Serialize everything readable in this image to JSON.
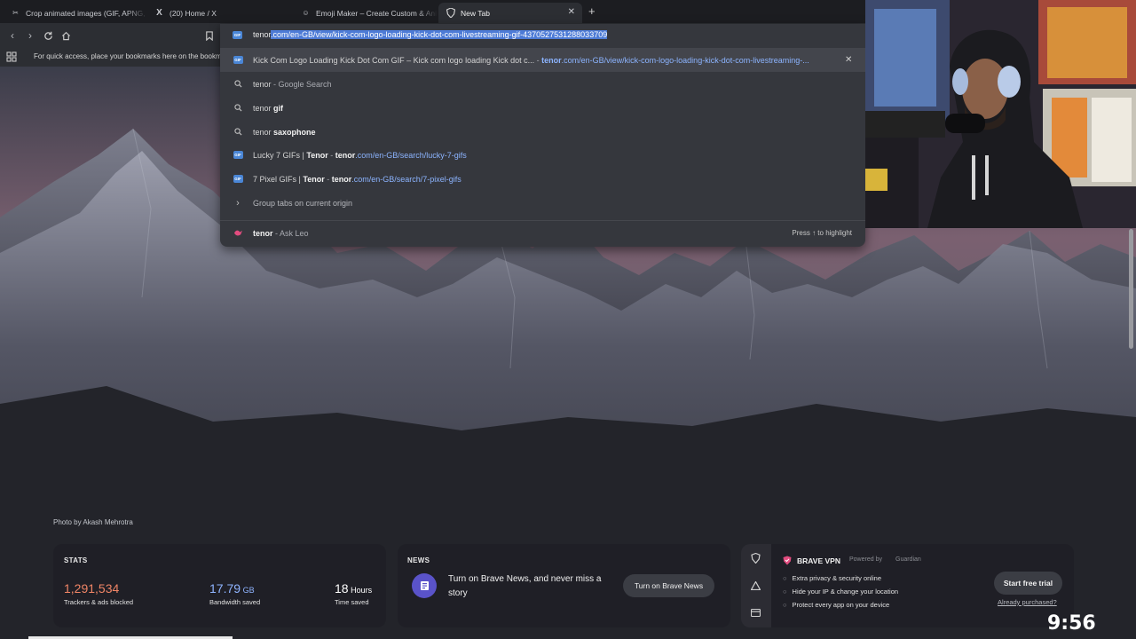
{
  "tabs": [
    {
      "title": "Crop animated images (GIF, APNG, W",
      "icon": "crop-icon"
    },
    {
      "title": "(20) Home / X",
      "icon": "x-logo-icon"
    },
    {
      "title": "Emoji Maker – Create Custom & Ani",
      "icon": "emoji-icon"
    },
    {
      "title": "New Tab",
      "icon": "brave-shield-icon",
      "active": true
    }
  ],
  "bookmarks_bar": {
    "text": "For quick access, place your bookmarks here on the bookm"
  },
  "omnibox": {
    "typed": "tenor",
    "completion": ".com/en-GB/view/kick-com-logo-loading-kick-dot-com-livestreaming-gif-4370527531288033709",
    "suggestions": [
      {
        "icon": "tenor-gif-icon",
        "title": "Kick Com Logo Loading Kick Dot Com GIF – Kick com logo loading Kick dot c...",
        "sep": " - ",
        "url_bold": "tenor",
        "url_rest": ".com/en-GB/view/kick-com-logo-loading-kick-dot-com-livestreaming-...",
        "removable": true
      },
      {
        "icon": "search-icon",
        "normal": "tenor",
        "rest": " - Google Search"
      },
      {
        "icon": "search-icon",
        "normal": "tenor ",
        "bold": "gif"
      },
      {
        "icon": "search-icon",
        "normal": "tenor ",
        "bold": "saxophone"
      },
      {
        "icon": "tenor-gif-icon",
        "title": "Lucky 7 GIFs | ",
        "title_bold": "Tenor",
        "sep": " - ",
        "url_bold": "tenor",
        "url_rest": ".com/en-GB/search/lucky-7-gifs"
      },
      {
        "icon": "tenor-gif-icon",
        "title": "7 Pixel GIFs | ",
        "title_bold": "Tenor",
        "sep": " - ",
        "url_bold": "tenor",
        "url_rest": ".com/en-GB/search/7-pixel-gifs"
      },
      {
        "icon": "chevron-right-icon",
        "text": "Group tabs on current origin"
      }
    ],
    "leo": {
      "query": "tenor",
      "rest": " - Ask Leo",
      "hint": "Press ↑ to highlight"
    }
  },
  "photo_credit": "Photo by Akash Mehrotra",
  "stats": {
    "title": "STATS",
    "trackers": {
      "value": "1,291,534",
      "label": "Trackers & ads blocked",
      "color": "#f08566"
    },
    "bandwidth": {
      "value": "17.79",
      "unit": "GB",
      "label": "Bandwidth saved",
      "color": "#8fb4ff"
    },
    "time": {
      "value": "18",
      "unit": "Hours",
      "label": "Time saved"
    }
  },
  "news": {
    "title": "NEWS",
    "text": "Turn on Brave News, and never miss a story",
    "button": "Turn on Brave News"
  },
  "vpn": {
    "title": "BRAVE VPN",
    "powered": "Powered by",
    "partner": "Guardian",
    "features": [
      "Extra privacy & security online",
      "Hide your IP & change your location",
      "Protect every app on your device"
    ],
    "button": "Start free trial",
    "link": "Already purchased?"
  },
  "clock": "9:56 pm"
}
